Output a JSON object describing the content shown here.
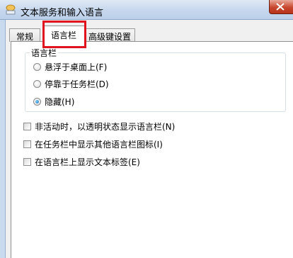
{
  "window": {
    "title": "文本服务和输入语言",
    "accent": "#e0141e"
  },
  "tabs": [
    {
      "label": "常规",
      "active": false
    },
    {
      "label": "语言栏",
      "active": true
    },
    {
      "label": "高级键设置",
      "active": false
    }
  ],
  "language_bar_group": {
    "legend": "语言栏",
    "options": [
      {
        "label": "悬浮于桌面上(F)",
        "checked": false
      },
      {
        "label": "停靠于任务栏(D)",
        "checked": false
      },
      {
        "label": "隐藏(H)",
        "checked": true
      }
    ]
  },
  "checkboxes": [
    {
      "label": "非活动时，以透明状态显示语言栏(N)",
      "checked": false
    },
    {
      "label": "在任务栏中显示其他语言栏图标(I)",
      "checked": false
    },
    {
      "label": "在语言栏上显示文本标签(E)",
      "checked": false
    }
  ]
}
